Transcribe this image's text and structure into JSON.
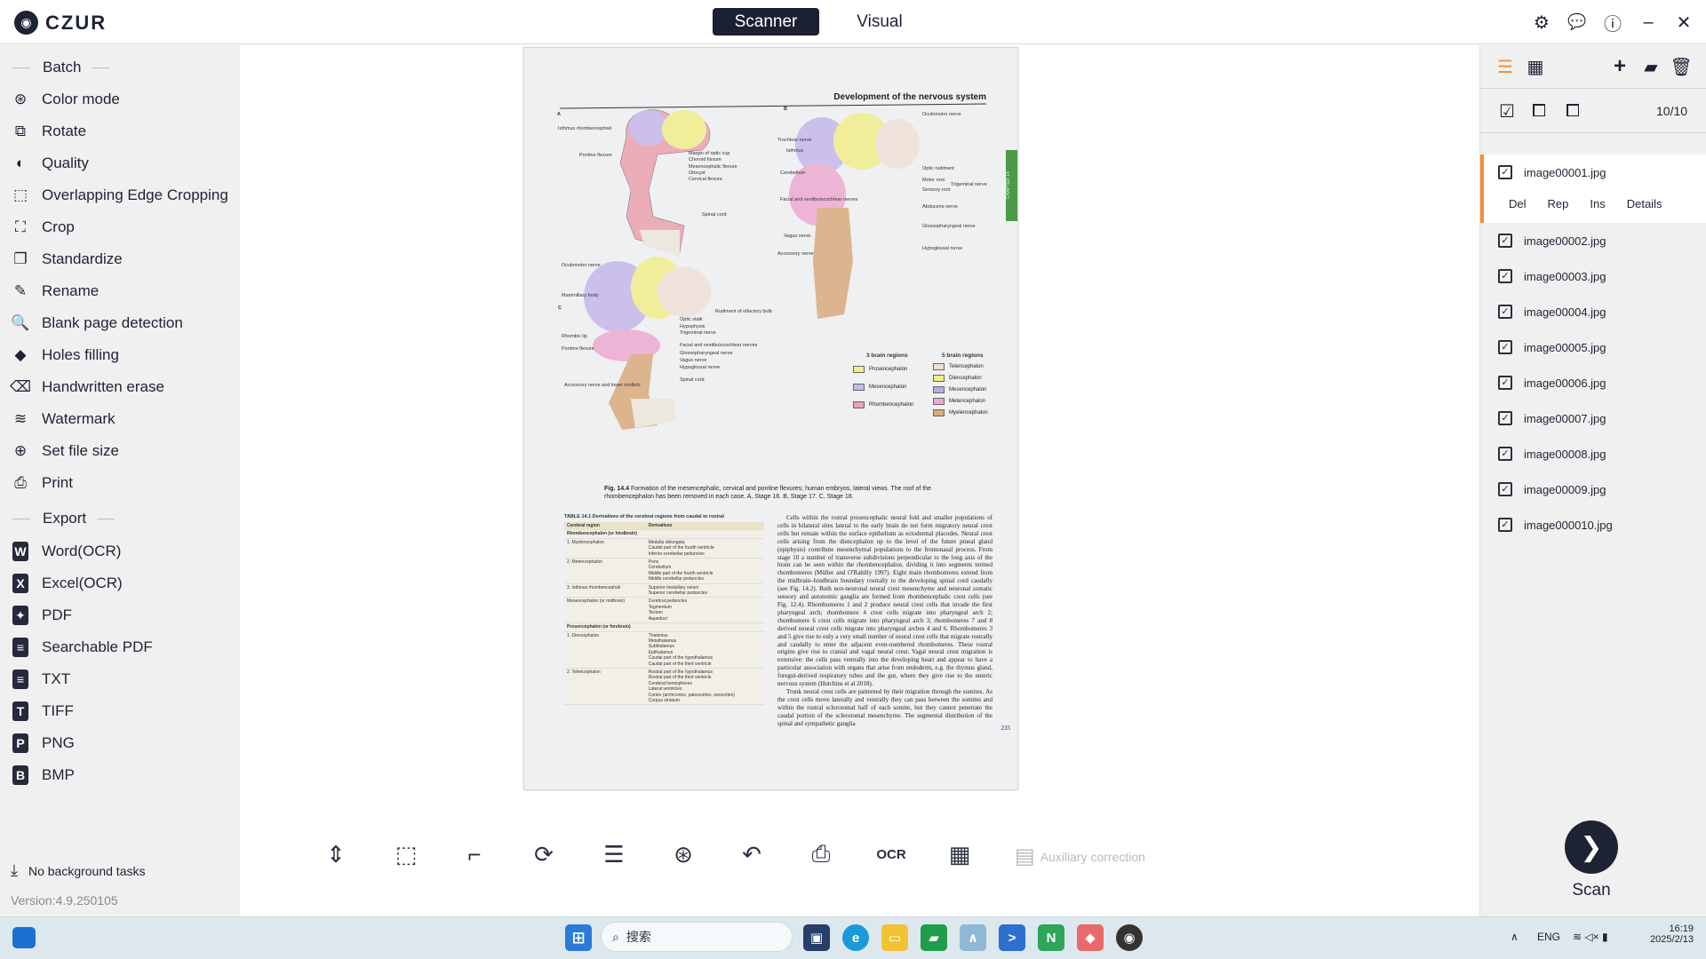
{
  "app": {
    "logo": "CZUR",
    "tabs": [
      "Scanner",
      "Visual"
    ],
    "active_tab": "Scanner",
    "header_icons": [
      "gear-icon",
      "feedback-icon",
      "help-icon",
      "minimize-icon",
      "close-icon"
    ]
  },
  "sidebar": {
    "batch_label": "Batch",
    "batch_items": [
      {
        "label": "Color mode",
        "icon": "color-mode-icon",
        "glyph": "⊛"
      },
      {
        "label": "Rotate",
        "icon": "rotate-icon",
        "glyph": "⧉"
      },
      {
        "label": "Quality",
        "icon": "quality-icon",
        "glyph": "◐"
      },
      {
        "label": "Overlapping Edge Cropping",
        "icon": "edge-crop-icon",
        "glyph": "⬚"
      },
      {
        "label": "Crop",
        "icon": "crop-icon",
        "glyph": "⛶"
      },
      {
        "label": "Standardize",
        "icon": "standardize-icon",
        "glyph": "❐"
      },
      {
        "label": "Rename",
        "icon": "rename-icon",
        "glyph": "✎"
      },
      {
        "label": "Blank page detection",
        "icon": "blank-page-icon",
        "glyph": "🔍"
      },
      {
        "label": "Holes filling",
        "icon": "fill-icon",
        "glyph": "◆"
      },
      {
        "label": "Handwritten erase",
        "icon": "eraser-icon",
        "glyph": "⌫"
      },
      {
        "label": "Watermark",
        "icon": "watermark-icon",
        "glyph": "≋"
      },
      {
        "label": "Set file size",
        "icon": "file-size-icon",
        "glyph": "⊕"
      },
      {
        "label": "Print",
        "icon": "print-icon",
        "glyph": "⎙"
      }
    ],
    "export_label": "Export",
    "export_items": [
      {
        "label": "Word(OCR)",
        "letter": "W"
      },
      {
        "label": "Excel(OCR)",
        "letter": "X"
      },
      {
        "label": "PDF",
        "letter": "✦"
      },
      {
        "label": "Searchable PDF",
        "letter": "≡"
      },
      {
        "label": "TXT",
        "letter": "≡"
      },
      {
        "label": "TIFF",
        "letter": "T"
      },
      {
        "label": "PNG",
        "letter": "P"
      },
      {
        "label": "BMP",
        "letter": "B"
      }
    ],
    "background_tasks": "No background tasks",
    "version": "Version:4.9.250105"
  },
  "document": {
    "running_title": "Development of the nervous system",
    "chapter_tab": "CHAPTER 14",
    "panel_labels": [
      "A",
      "B",
      "C"
    ],
    "labels_a": [
      "Isthmus rhombencephali",
      "Pontine flexure",
      "Margin of optic cup",
      "Choroid fissure",
      "Mesencephalic flexure",
      "Otocyst",
      "Cervical flexure",
      "Spinal cord"
    ],
    "labels_b": [
      "Oculomotor nerve",
      "Trochlear nerve",
      "Isthmus",
      "Cerebellum",
      "Optic rudiment",
      "Motor root",
      "Sensory root",
      "Trigeminal nerve",
      "Facial and vestibulocochlear nerves",
      "Abducens nerve",
      "Glossopharyngeal nerve",
      "Vagus nerve",
      "Hypoglossal nerve",
      "Accessory nerve"
    ],
    "labels_c": [
      "Oculomotor nerve",
      "Mammillary body",
      "Rhombic lip",
      "Pontine flexure",
      "Rudiment of olfactory bulb",
      "Optic stalk",
      "Hypophysis",
      "Trigeminal nerve",
      "Facial and vestibulocochlear nerves",
      "Glossopharyngeal nerve",
      "Vagus nerve",
      "Hypoglossal nerve",
      "Spinal cord",
      "Accessory nerve and lower rootlets"
    ],
    "legend": {
      "three_title": "3 brain regions",
      "five_title": "5 brain regions",
      "three": [
        {
          "name": "Prosencephalon",
          "color": "#f2ee8a"
        },
        {
          "name": "Mesencephalon",
          "color": "#c5b8ec"
        },
        {
          "name": "Rhombencephalon",
          "color": "#eba3b0"
        }
      ],
      "five": [
        {
          "name": "Telencephalon",
          "color": "#eee0d6"
        },
        {
          "name": "Diencephalon",
          "color": "#f2ee8a"
        },
        {
          "name": "Mesencephalon",
          "color": "#b9a8e4"
        },
        {
          "name": "Metencephalon",
          "color": "#eeaad0"
        },
        {
          "name": "Myelencephalon",
          "color": "#d9aa7c"
        }
      ]
    },
    "caption_bold": "Fig. 14.4",
    "caption": "Formation of the mesencephalic, cervical and pontine flexures; human embryos, lateral views. The roof of the rhombencephalon has been removed in each case. A, Stage 16. B, Stage 17. C, Stage 18.",
    "table_title": "TABLE 14.1 Derivatives of the cerebral regions from caudal to rostral",
    "table_headers": [
      "Cerebral region",
      "Derivatives"
    ],
    "table_rows": [
      {
        "group": "Rhombencephalon (or hindbrain)"
      },
      {
        "region": "1. Myelencephalon",
        "derivatives": "Medulla oblongata\nCaudal part of the fourth ventricle\nInferior cerebellar peduncles"
      },
      {
        "region": "2. Metencephalon",
        "derivatives": "Pons\nCerebellum\nMiddle part of the fourth ventricle\nMiddle cerebellar peduncles"
      },
      {
        "region": "3. Isthmus rhombencephali",
        "derivatives": "Superior medullary velum\nSuperior cerebellar peduncles"
      },
      {
        "region": "Mesencephalon (or midbrain)",
        "derivatives": "Cerebral peduncles\nTegmentum\nTectum\nAqueduct"
      },
      {
        "group": "Prosencephalon (or forebrain)"
      },
      {
        "region": "1. Diencephalon",
        "derivatives": "Thalamus\nMetathalamus\nSubthalamus\nEpithalamus\nCaudal part of the hypothalamus\nCaudal part of the third ventricle"
      },
      {
        "region": "2. Telencephalon",
        "derivatives": "Rostral part of the hypothalamus\nRostral part of the third ventricle\nCerebral hemispheres\nLateral ventricles\nCortex (archicortex, paleocortex, neocortex)\nCorpus striatum"
      }
    ],
    "body_p1": "Cells within the rostral prosencephalic neural fold and smaller populations of cells in bilateral sites lateral to the early brain do not form migratory neural crest cells but remain within the surface epithelium as ectodermal placodes. Neural crest cells arising from the diencephalon up to the level of the future pineal gland (epiphysis) contribute mesenchymal populations to the frontonasal process. From stage 10 a number of transverse subdivisions perpendicular to the long axis of the brain can be seen within the rhombencephalon, dividing it into segments termed rhombomeres (Müller and O'Rahilly 1997). Eight main rhombomeres extend from the midbrain–hindbrain boundary rostrally to the developing spinal cord caudally (see Fig. 14.2). Both non-neuronal neural crest mesenchyme and neuronal somatic sensory and autonomic ganglia are formed from rhombencephalic crest cells (see Fig. 12.4). Rhombomeres 1 and 2 produce neural crest cells that invade the first pharyngeal arch; rhombomere 4 crest cells migrate into pharyngeal arch 2; rhombomere 6 crest cells migrate into pharyngeal arch 3; rhombomeres 7 and 8 derived neural crest cells migrate into pharyngeal arches 4 and 6. Rhombomeres 3 and 5 give rise to only a very small number of neural crest cells that migrate rostrally and caudally to enter the adjacent even-numbered rhombomeres. These rostral origins give rise to cranial and vagal neural crest. Vagal neural crest migration is extensive: the cells pass ventrally into the developing heart and appear to have a particular association with organs that arise from endoderm, e.g. the thymus gland, foregut-derived respiratory tubes and the gut, where they give rise to the enteric nervous system (Hutchins et al 2018).",
    "body_p2": "Trunk neural crest cells are patterned by their migration through the somites. As the crest cells move laterally and ventrally they can pass between the somites and within the rostral sclerotomal half of each somite, but they cannot penetrate the caudal portion of the sclerotomal mesenchyme. The segmental distribution of the spinal and sympathetic ganglia",
    "page_number": "235"
  },
  "toolbar": {
    "tools": [
      {
        "name": "fit-height",
        "glyph": "⇕"
      },
      {
        "name": "select-area",
        "glyph": "⬚"
      },
      {
        "name": "crop",
        "glyph": "⌐"
      },
      {
        "name": "rotate",
        "glyph": "⟳"
      },
      {
        "name": "adjust",
        "glyph": "☰"
      },
      {
        "name": "color-mode",
        "glyph": "⊛"
      },
      {
        "name": "undo",
        "glyph": "↶"
      },
      {
        "name": "print",
        "glyph": "⎙"
      },
      {
        "name": "ocr",
        "glyph": "OCR"
      },
      {
        "name": "qr-code",
        "glyph": "▦"
      }
    ],
    "auxiliary_label": "Auxiliary correction"
  },
  "right_panel": {
    "count": "10/10",
    "selected_actions": [
      "Del",
      "Rep",
      "Ins",
      "Details"
    ],
    "accent": "#f0913a",
    "files": [
      {
        "name": "image00001.jpg",
        "checked": true
      },
      {
        "name": "image00002.jpg",
        "checked": true
      },
      {
        "name": "image00003.jpg",
        "checked": true
      },
      {
        "name": "image00004.jpg",
        "checked": true
      },
      {
        "name": "image00005.jpg",
        "checked": true
      },
      {
        "name": "image00006.jpg",
        "checked": true
      },
      {
        "name": "image00007.jpg",
        "checked": true
      },
      {
        "name": "image00008.jpg",
        "checked": true
      },
      {
        "name": "image00009.jpg",
        "checked": true
      },
      {
        "name": "image000010.jpg",
        "checked": true
      }
    ],
    "scan_label": "Scan"
  },
  "taskbar": {
    "search_placeholder": "搜索",
    "lang": "ENG",
    "time": "16:19",
    "date": "2025/2/13"
  }
}
